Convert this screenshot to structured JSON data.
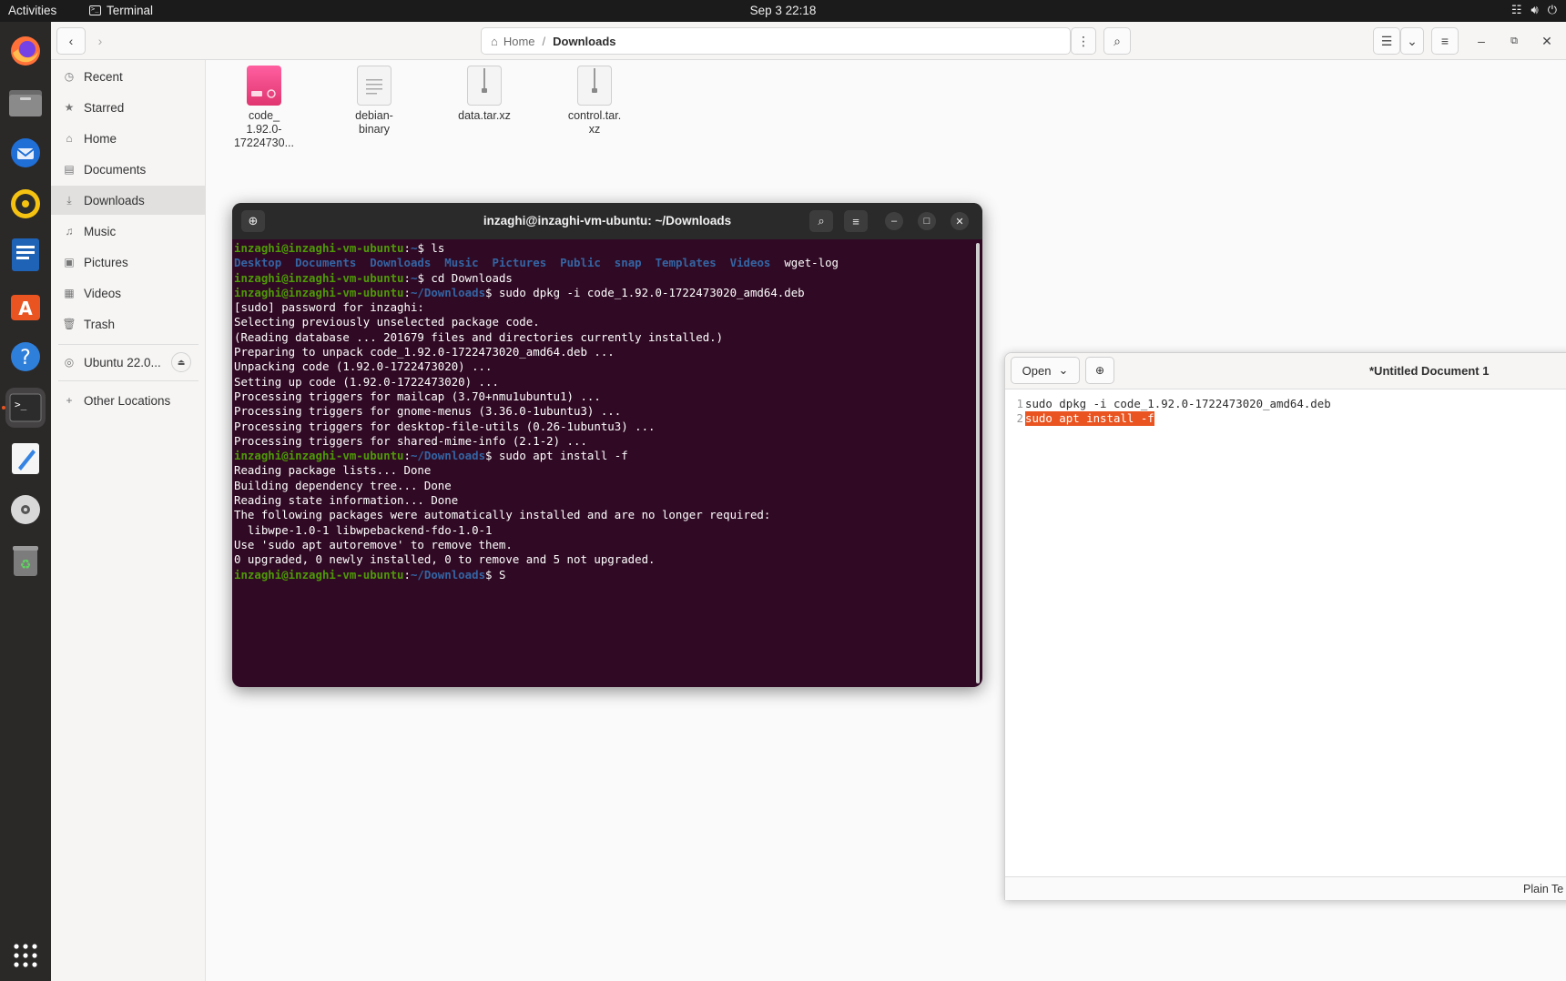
{
  "topbar": {
    "activities": "Activities",
    "app_name": "Terminal",
    "clock": "Sep 3  22:18"
  },
  "dock": {
    "apps": [
      "firefox-icon",
      "files-icon",
      "thunderbird-icon",
      "rhythmbox-icon",
      "writer-icon",
      "app-center-icon",
      "help-icon",
      "terminal-icon",
      "text-editor-icon",
      "disc-icon",
      "trash-icon",
      "show-apps-icon"
    ]
  },
  "files": {
    "path": {
      "home": "Home",
      "current": "Downloads"
    },
    "sidebar": [
      "Recent",
      "Starred",
      "Home",
      "Documents",
      "Downloads",
      "Music",
      "Pictures",
      "Videos",
      "Trash",
      "Ubuntu 22.0...",
      "Other Locations"
    ],
    "items": [
      {
        "line1": "code_",
        "line2": "1.92.0-",
        "line3": "17224730..."
      },
      {
        "line1": "debian-",
        "line2": "binary",
        "line3": ""
      },
      {
        "line1": "data.tar.xz",
        "line2": "",
        "line3": ""
      },
      {
        "line1": "control.tar.",
        "line2": "xz",
        "line3": ""
      }
    ]
  },
  "terminal": {
    "title": "inzaghi@inzaghi-vm-ubuntu: ~/Downloads",
    "prompt_user": "inzaghi@inzaghi-vm-ubuntu",
    "home": "~",
    "downloads": "~/Downloads",
    "lines": {
      "cmd_ls": "ls",
      "ls_dirs": [
        "Desktop",
        "Documents",
        "Downloads",
        "Music",
        "Pictures",
        "Public",
        "snap",
        "Templates",
        "Videos"
      ],
      "ls_file": "wget-log",
      "cmd_cd": "cd Downloads",
      "cmd_dpkg": "sudo dpkg -i code_1.92.0-1722473020_amd64.deb",
      "o1": "[sudo] password for inzaghi:",
      "o2": "Selecting previously unselected package code.",
      "o3": "(Reading database ... 201679 files and directories currently installed.)",
      "o4": "Preparing to unpack code_1.92.0-1722473020_amd64.deb ...",
      "o5": "Unpacking code (1.92.0-1722473020) ...",
      "o6": "Setting up code (1.92.0-1722473020) ...",
      "o7": "Processing triggers for mailcap (3.70+nmu1ubuntu1) ...",
      "o8": "Processing triggers for gnome-menus (3.36.0-1ubuntu3) ...",
      "o9": "Processing triggers for desktop-file-utils (0.26-1ubuntu3) ...",
      "o10": "Processing triggers for shared-mime-info (2.1-2) ...",
      "cmd_apt": "sudo apt install -f",
      "a1": "Reading package lists... Done",
      "a2": "Building dependency tree... Done",
      "a3": "Reading state information... Done",
      "a4": "The following packages were automatically installed and are no longer required:",
      "a5": "  libwpe-1.0-1 libwpebackend-fdo-1.0-1",
      "a6": "Use 'sudo apt autoremove' to remove them.",
      "a7": "0 upgraded, 0 newly installed, 0 to remove and 5 not upgraded.",
      "cmd_last": "S"
    }
  },
  "editor": {
    "open_label": "Open",
    "title": "*Untitled Document 1",
    "lines": [
      {
        "num": "1",
        "text": "sudo dpkg -i code_1.92.0-1722473020_amd64.deb"
      },
      {
        "num": "2",
        "text": "sudo apt install -f"
      }
    ],
    "status": "Plain Te"
  }
}
